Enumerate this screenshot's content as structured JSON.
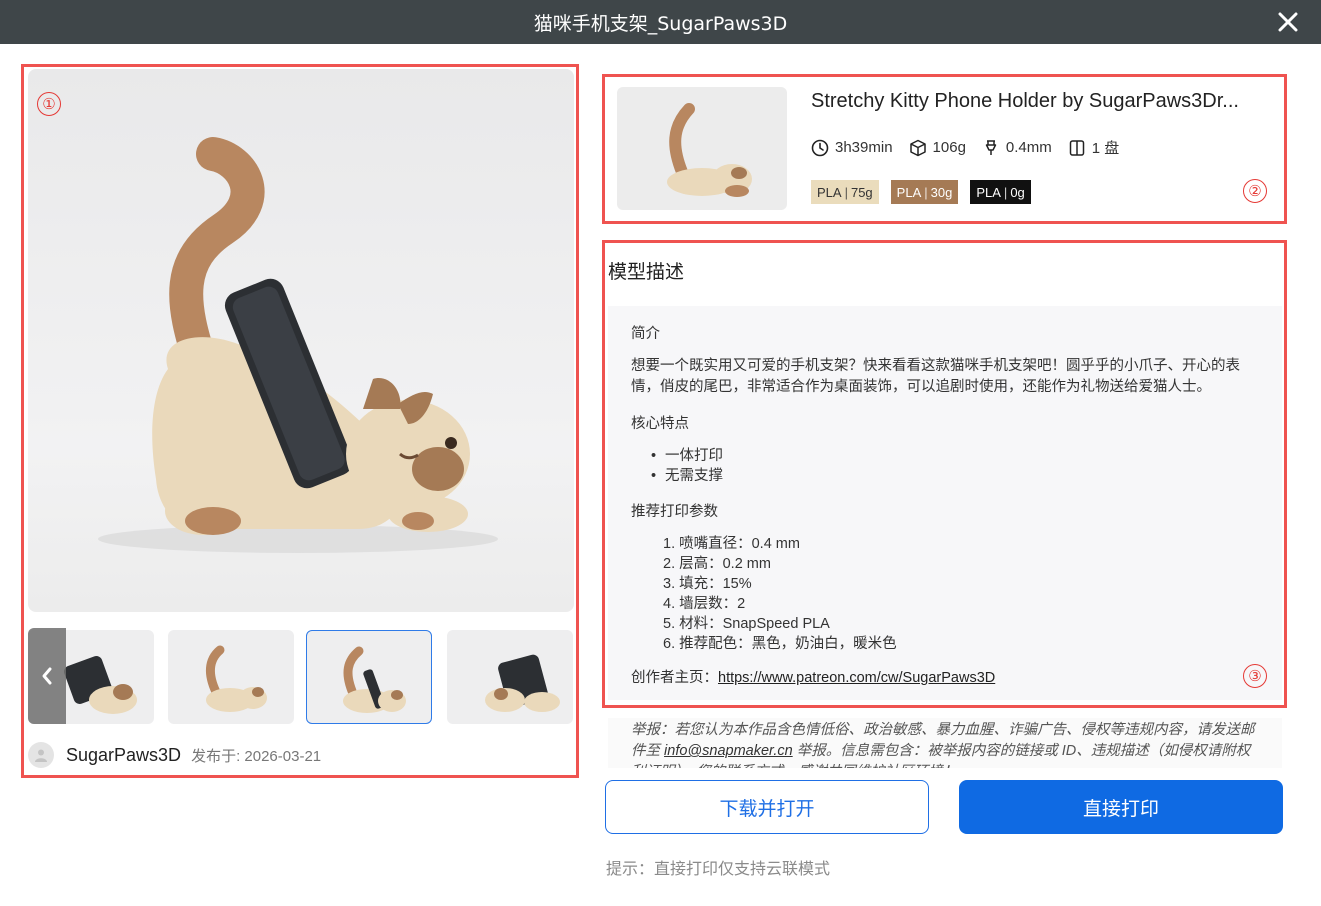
{
  "window": {
    "title": "猫咪手机支架_SugarPaws3D"
  },
  "markers": [
    "①",
    "②",
    "③"
  ],
  "gallery": {
    "thumbnail_count": 4,
    "selected_index": 2
  },
  "author": {
    "name": "SugarPaws3D",
    "published": "发布于: 2026-03-21"
  },
  "model": {
    "title": "Stretchy Kitty Phone Holder by SugarPaws3Dr...",
    "stats": {
      "time": "3h39min",
      "weight": "106g",
      "nozzle": "0.4mm",
      "plates": "1 盘"
    },
    "filaments": [
      {
        "type": "PLA",
        "amount": "75g",
        "color": "#eadcbc",
        "text_color": "#333333"
      },
      {
        "type": "PLA",
        "amount": "30g",
        "color": "#a57a55",
        "text_color": "#ffffff"
      },
      {
        "type": "PLA",
        "amount": "0g",
        "color": "#111111",
        "text_color": "#ffffff"
      }
    ]
  },
  "description": {
    "heading": "模型描述",
    "intro_title": "简介",
    "intro_text": "想要一个既实用又可爱的手机支架？快来看看这款猫咪手机支架吧！圆乎乎的小爪子、开心的表情，俏皮的尾巴，非常适合作为桌面装饰，可以追剧时使用，还能作为礼物送给爱猫人士。",
    "features_title": "核心特点",
    "features": [
      "一体打印",
      "无需支撑"
    ],
    "params_title": "推荐打印参数",
    "params": [
      "1. 喷嘴直径：0.4 mm",
      "2. 层高：0.2 mm",
      "3. 填充：15%",
      "4. 墙层数：2",
      "5. 材料：SnapSpeed PLA",
      "6. 推荐配色：黑色，奶油白，暖米色"
    ],
    "creator_label": "创作者主页：",
    "creator_link": "https://www.patreon.com/cw/SugarPaws3D"
  },
  "report": {
    "text_before": "举报：若您认为本作品含色情低俗、政治敏感、暴力血腥、诈骗广告、侵权等违规内容，请发送邮件至 ",
    "email": "info@snapmaker.cn",
    "text_after": " 举报。信息需包含：被举报内容的链接或 ID、违规描述（如侵权请附权利证明）、您的联系方式。感谢共同维护社区环境！"
  },
  "actions": {
    "download_label": "下载并打开",
    "print_label": "直接打印"
  },
  "hint": "提示：直接打印仅支持云联模式",
  "colors": {
    "titlebar": "#3f4649",
    "highlight_box": "#ef5350",
    "primary": "#0f6ae3"
  }
}
